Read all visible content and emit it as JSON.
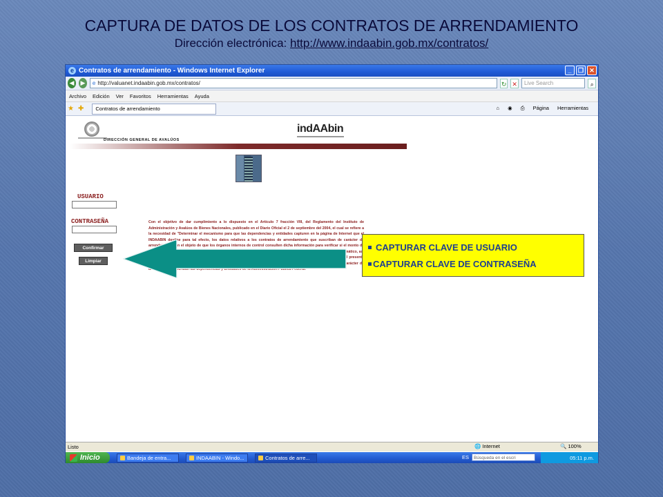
{
  "slide": {
    "title": "CAPTURA DE DATOS DE LOS CONTRATOS DE ARRENDAMIENTO",
    "subtitle_label": "Dirección electrónica:",
    "subtitle_url": "http://www.indaabin.gob.mx/contratos/"
  },
  "browser": {
    "window_title": "Contratos de arrendamiento - Windows Internet Explorer",
    "address": "http://valuanet.indaabin.gob.mx/contratos/",
    "search_placeholder": "Live Search",
    "menu": [
      "Archivo",
      "Edición",
      "Ver",
      "Favoritos",
      "Herramientas",
      "Ayuda"
    ],
    "tab_label": "Contratos de arrendamiento",
    "tools": {
      "page": "Página",
      "tools": "Herramientas"
    }
  },
  "webpage": {
    "agency": "DIRECCIÓN GENERAL DE AVALÚOS",
    "logo": "indAAbin",
    "user_label": "USUARIO",
    "password_label": "CONTRASEÑA",
    "confirm_button": "Confirmar",
    "clear_button": "Limpiar",
    "body_text": "Con el objetivo de dar cumplimiento a lo dispuesto en el Artículo 7 fracción VIII, del Reglamento del Instituto de Administración y Avalúos de Bienes Nacionales, publicado en el Diario Oficial el 2 de septiembre del 2004, el cual se refiere a la necesidad de \"Determinar el mecanismo para que las dependencias y entidades capturen en la página de Internet que el INDAABIN destine para tal efecto, los datos relativos a los contratos de arrendamiento que suscriban de carácter de arrendatarias, con el objeto de que los órganos internos de control consulten dicha información para verificar si el monto de la renta y la vigencia de cada contrato se sujeta a una justipreciación de renta específica o a una de carácter automático, así como a la normatividad aplicable.\" El envío de los datos relativos a los contratos de arrendamiento, a través del presente medio de comunicación remota, sustituye el envío de los contratos de arrendamiento de inmuebles que en su carácter de arrendatarios suscriban las dependencias y Entidades de la Administración Pública Federal."
  },
  "callout": {
    "items": [
      "CAPTURAR CLAVE DE USUARIO",
      "CAPTURAR CLAVE DE CONTRASEÑA"
    ],
    "background": "#ffff00",
    "text_color": "#1f3f8f"
  },
  "arrow_color": "#0b8f86",
  "statusbar": {
    "status": "Listo",
    "zone": "Internet",
    "zoom": "100%"
  },
  "taskbar": {
    "start": "Inicio",
    "tasks": [
      "Bandeja de entra...",
      "INDAABIN - Windo...",
      "Contratos de arre..."
    ],
    "lang": "ES",
    "search": "Búsqueda en el escri",
    "clock": "05:11 p.m."
  }
}
